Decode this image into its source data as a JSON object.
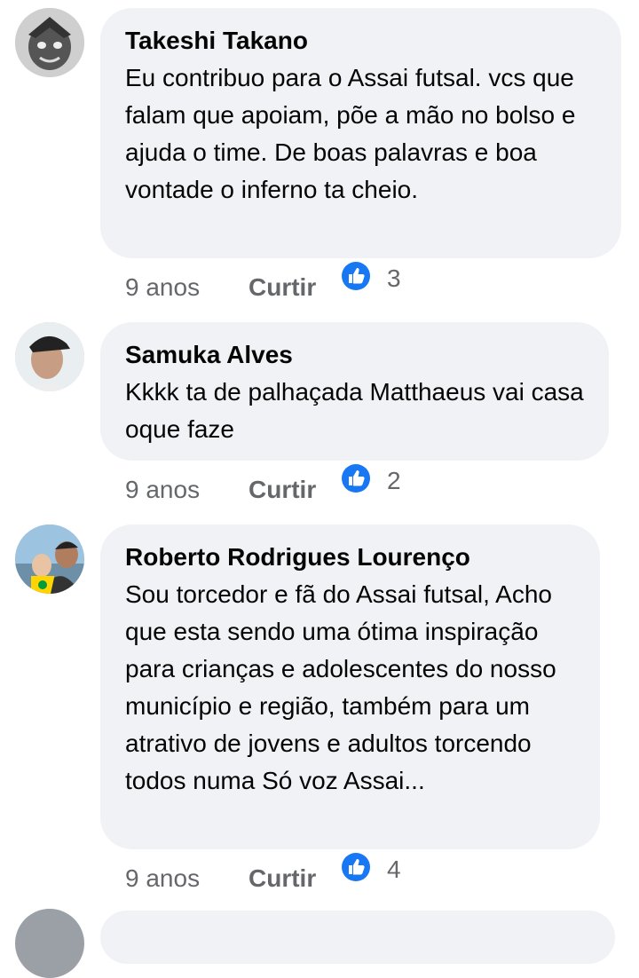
{
  "comments": [
    {
      "author": "Takeshi Takano",
      "text": "Eu contribuo para o Assai futsal. vcs que falam que apoiam, põe a mão no bolso e ajuda o time. De boas palavras e boa vontade o inferno ta cheio.",
      "time": "9 anos",
      "like_label": "Curtir",
      "reactions": "3"
    },
    {
      "author": "Samuka Alves",
      "text": "Kkkk ta de palhaçada Matthaeus vai casa oque faze",
      "time": "9 anos",
      "like_label": "Curtir",
      "reactions": "2"
    },
    {
      "author": "Roberto Rodrigues Lourenço",
      "text": "Sou torcedor e fã do Assai futsal, Acho que esta sendo uma ótima inspiração para crianças e adolescentes do nosso município e região, também para um atrativo de jovens e adultos torcendo todos numa Só voz Assai...",
      "time": "9 anos",
      "like_label": "Curtir",
      "reactions": "4"
    }
  ],
  "colors": {
    "bubble": "#f0f2f5",
    "meta": "#65676b",
    "like_blue": "#1877f2"
  }
}
